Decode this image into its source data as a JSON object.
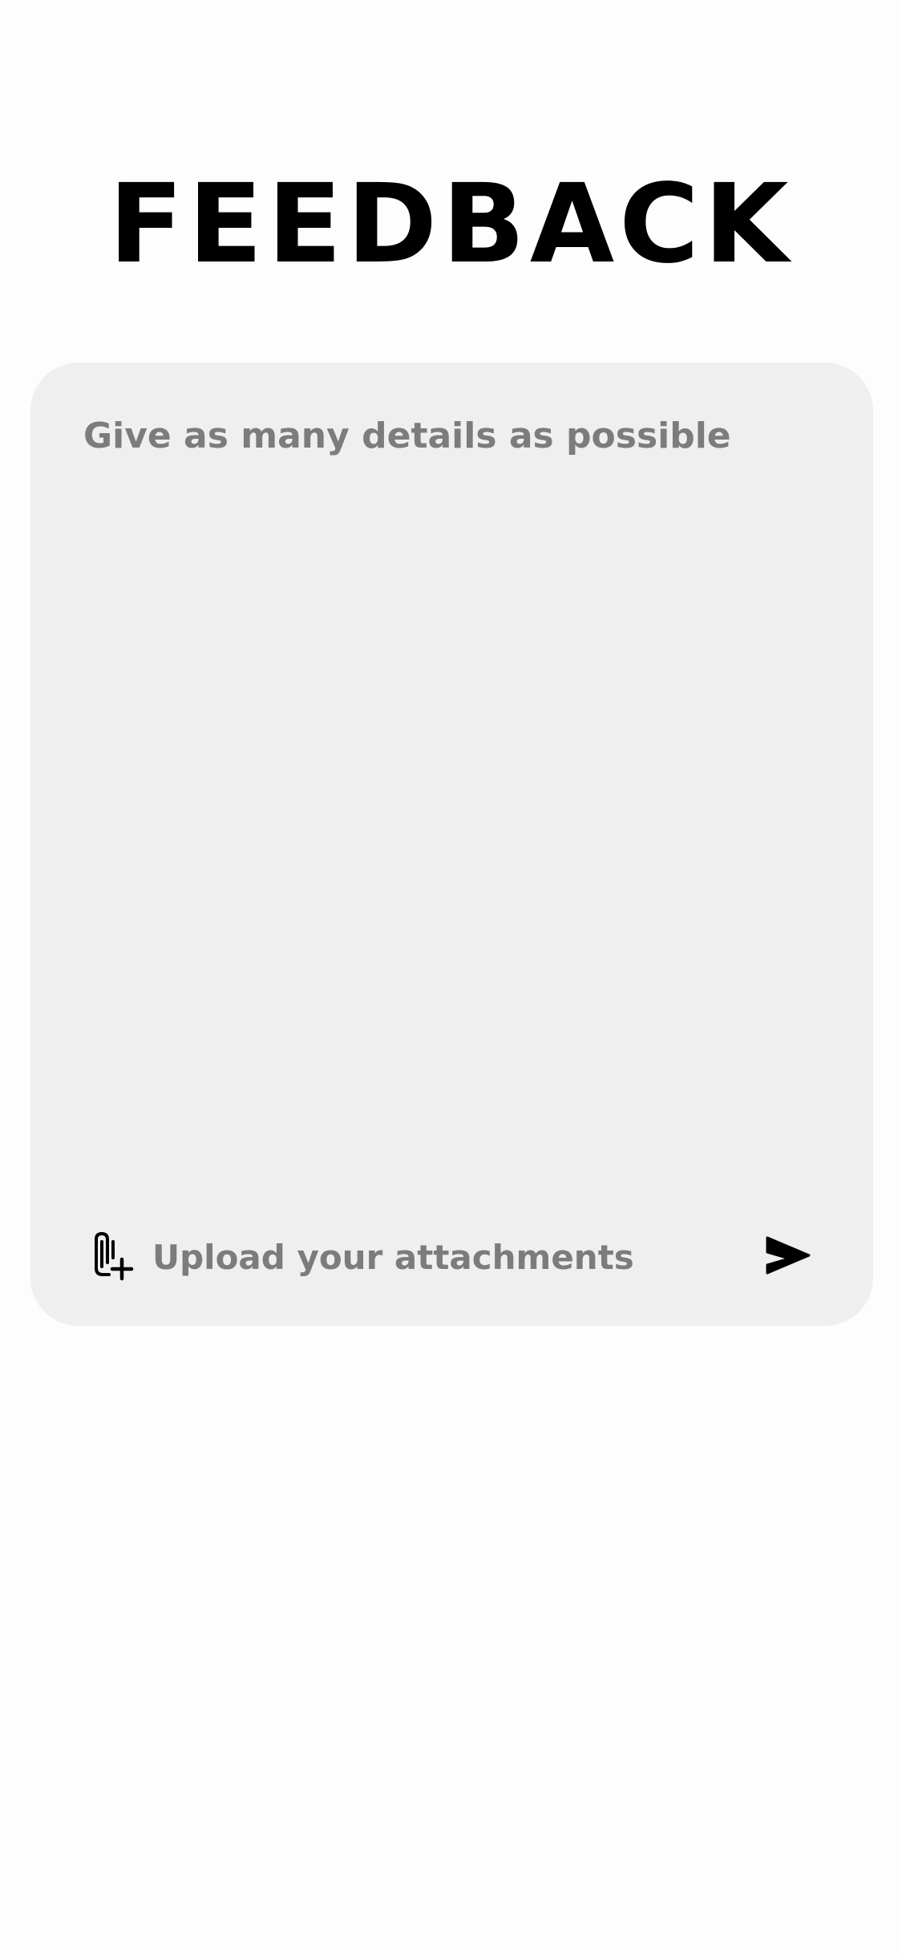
{
  "header": {
    "title": "FEEDBACK"
  },
  "feedback_form": {
    "details_placeholder": "Give as many details as possible",
    "details_value": "",
    "attachment_label": "Upload your attachments",
    "attachment_icon": "paperclip-plus-icon",
    "send_icon": "send-arrow-icon"
  },
  "colors": {
    "page_background": "#fdfdfd",
    "card_background": "#efefef",
    "title_text": "#000000",
    "placeholder_text": "#7c7c7c",
    "icon": "#000000"
  }
}
